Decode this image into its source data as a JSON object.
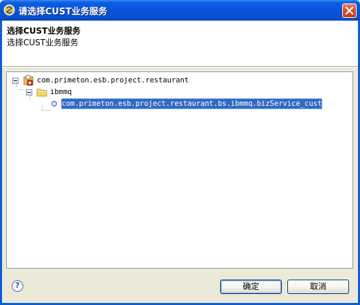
{
  "window": {
    "title": "请选择CUST业务服务"
  },
  "header": {
    "title": "选择CUST业务服务",
    "description": "选择CUST业务服务"
  },
  "tree": {
    "root": {
      "label": "com.primeton.esb.project.restaurant",
      "icon": "project-icon",
      "expanded": true
    },
    "folder": {
      "label": "ibmmq",
      "icon": "folder-icon",
      "expanded": true
    },
    "leaf": {
      "label": "com.primeton.esb.project.restaurant.bs.ibmmq.bizService_cust",
      "icon": "service-icon",
      "selected": true
    }
  },
  "buttons": {
    "ok_label": "确定",
    "cancel_label": "取消"
  },
  "colors": {
    "titlebar": "#0853d8",
    "selection": "#316ac5",
    "dialog_bg": "#ece9d8"
  }
}
